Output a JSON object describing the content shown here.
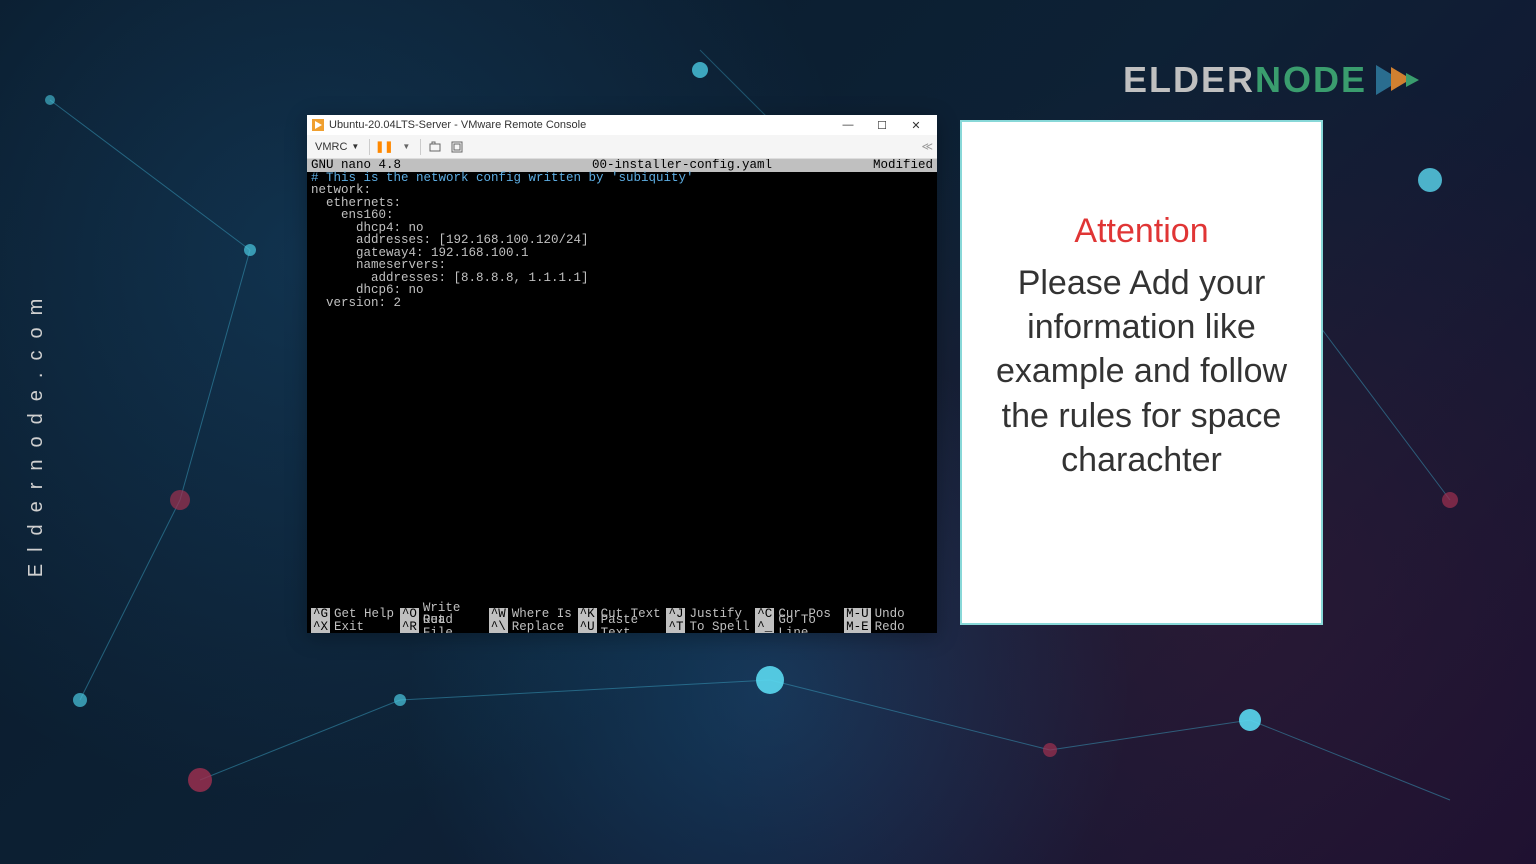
{
  "branding": {
    "vertical": "Eldernode.com",
    "logo_elder": "ELDER",
    "logo_node": "NODE"
  },
  "window": {
    "title": "Ubuntu-20.04LTS-Server - VMware Remote Console",
    "toolbar": {
      "menu": "VMRC"
    }
  },
  "nano": {
    "app": "GNU nano 4.8",
    "filename": "00-installer-config.yaml",
    "status": "Modified",
    "comment": "# This is the network config written by 'subiquity'",
    "content": "network:\n  ethernets:\n    ens160:\n      dhcp4: no\n      addresses: [192.168.100.120/24]\n      gateway4: 192.168.100.1\n      nameservers:\n        addresses: [8.8.8.8, 1.1.1.1]\n      dhcp6: no\n  version: 2",
    "footer": {
      "row1": [
        {
          "key": "^G",
          "label": "Get Help"
        },
        {
          "key": "^O",
          "label": "Write Out"
        },
        {
          "key": "^W",
          "label": "Where Is"
        },
        {
          "key": "^K",
          "label": "Cut Text"
        },
        {
          "key": "^J",
          "label": "Justify"
        },
        {
          "key": "^C",
          "label": "Cur Pos"
        },
        {
          "key": "M-U",
          "label": "Undo"
        }
      ],
      "row2": [
        {
          "key": "^X",
          "label": "Exit"
        },
        {
          "key": "^R",
          "label": "Read File"
        },
        {
          "key": "^\\",
          "label": "Replace"
        },
        {
          "key": "^U",
          "label": "Paste Text"
        },
        {
          "key": "^T",
          "label": "To Spell"
        },
        {
          "key": "^_",
          "label": "Go To Line"
        },
        {
          "key": "M-E",
          "label": "Redo"
        }
      ]
    }
  },
  "attention": {
    "title": "Attention",
    "body": "Please Add your information like example and follow the rules for space charachter"
  }
}
